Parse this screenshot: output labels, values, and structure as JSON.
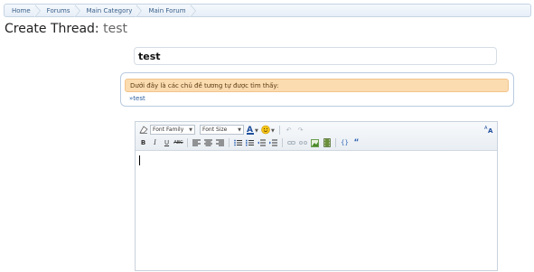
{
  "breadcrumb": {
    "items": [
      "Home",
      "Forums",
      "Main Category",
      "Main Forum"
    ]
  },
  "page": {
    "title_prefix": "Create Thread:",
    "title_thread": "test"
  },
  "thread_title": {
    "value": "test"
  },
  "similar_threads": {
    "header": "Dưới đây là các chủ đề tương tự được tìm thấy:",
    "items": [
      "»test"
    ]
  },
  "editor": {
    "font_family_label": "Font Family",
    "font_size_label": "Font Size",
    "icons_row1": [
      "remove-formatting-icon",
      "text-color-icon",
      "smilies-icon",
      "undo-icon",
      "redo-icon",
      "toggle-source-icon"
    ],
    "icons_row2": [
      "bold-icon",
      "italic-icon",
      "underline-icon",
      "strikethrough-icon",
      "align-left-icon",
      "align-center-icon",
      "align-right-icon",
      "bullet-list-icon",
      "numbered-list-icon",
      "outdent-icon",
      "indent-icon",
      "link-icon",
      "unlink-icon",
      "image-icon",
      "media-icon",
      "code-icon",
      "quote-icon"
    ]
  },
  "colors": {
    "breadcrumb_border": "#c6d4e3",
    "link_blue": "#2a5c9c",
    "similar_header_bg": "#fbdcb1"
  }
}
